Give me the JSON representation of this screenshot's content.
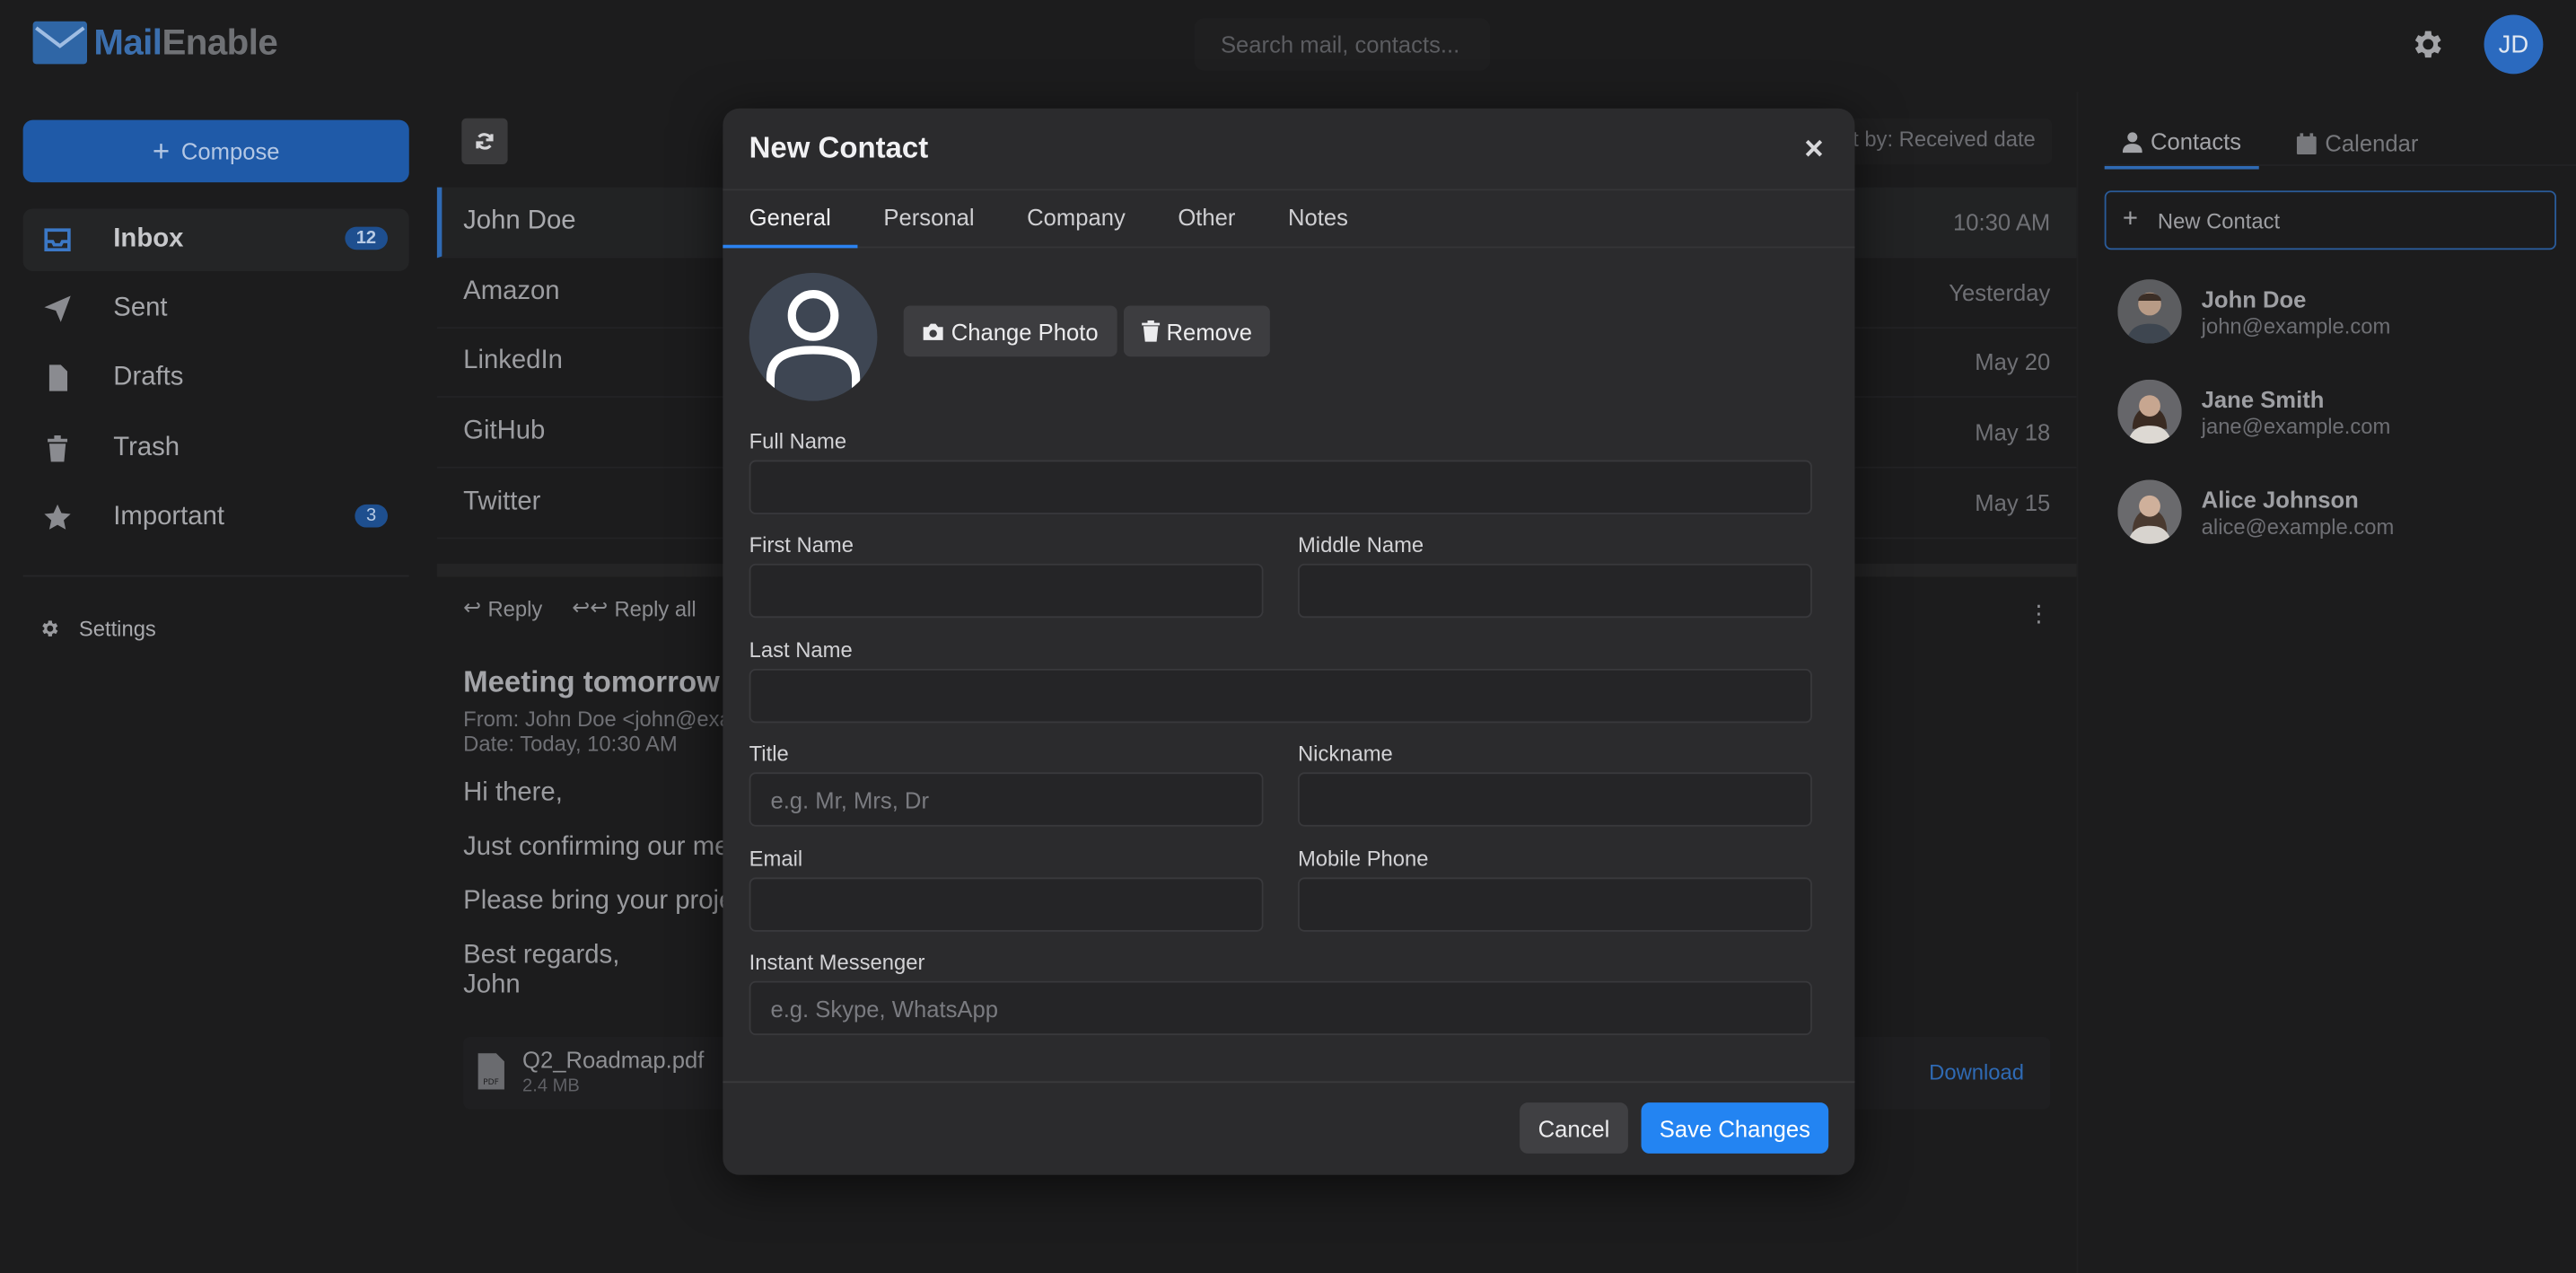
{
  "header": {
    "logo_part1": "Mail",
    "logo_part2": "Enable",
    "search_placeholder": "Search mail, contacts...",
    "avatar_initials": "JD"
  },
  "sidebar": {
    "compose_label": "Compose",
    "items": [
      {
        "label": "Inbox",
        "icon": "inbox-icon",
        "badge": "12",
        "active": true
      },
      {
        "label": "Sent",
        "icon": "paper-plane-icon",
        "badge": ""
      },
      {
        "label": "Drafts",
        "icon": "file-icon",
        "badge": ""
      },
      {
        "label": "Trash",
        "icon": "trash-icon",
        "badge": ""
      },
      {
        "label": "Important",
        "icon": "star-icon",
        "badge": "3"
      }
    ],
    "settings_label": "Settings"
  },
  "mail_list": {
    "sort_label": "Sort by: Received date",
    "rows": [
      {
        "sender": "John Doe",
        "time": "10:30 AM"
      },
      {
        "sender": "Amazon",
        "time": "Yesterday"
      },
      {
        "sender": "LinkedIn",
        "time": "May 20"
      },
      {
        "sender": "GitHub",
        "time": "May 18"
      },
      {
        "sender": "Twitter",
        "time": "May 15"
      }
    ]
  },
  "reading": {
    "actions": [
      "Reply",
      "Reply all"
    ],
    "subject": "Meeting tomorrow",
    "from": "From: John Doe <john@exa",
    "date": "Date: Today, 10:30 AM",
    "lines": [
      "Hi there,",
      "Just confirming our me",
      "Please bring your proje"
    ],
    "signoff1": "Best regards,",
    "signoff2": "John",
    "attachment_name": "Q2_Roadmap.pdf",
    "attachment_size": "2.4 MB",
    "download_label": "Download"
  },
  "right_panel": {
    "tabs": [
      "Contacts",
      "Calendar"
    ],
    "new_contact_label": "New Contact",
    "contacts": [
      {
        "name": "John Doe",
        "email": "john@example.com"
      },
      {
        "name": "Jane Smith",
        "email": "jane@example.com"
      },
      {
        "name": "Alice Johnson",
        "email": "alice@example.com"
      }
    ]
  },
  "modal": {
    "title": "New Contact",
    "close": "×",
    "tabs": [
      "General",
      "Personal",
      "Company",
      "Other",
      "Notes"
    ],
    "change_photo": "Change Photo",
    "remove": "Remove",
    "fields": {
      "full_name": {
        "label": "Full Name",
        "value": "",
        "placeholder": ""
      },
      "first_name": {
        "label": "First Name",
        "value": "",
        "placeholder": ""
      },
      "middle_name": {
        "label": "Middle Name",
        "value": "",
        "placeholder": ""
      },
      "last_name": {
        "label": "Last Name",
        "value": "",
        "placeholder": ""
      },
      "title": {
        "label": "Title",
        "value": "",
        "placeholder": "e.g. Mr, Mrs, Dr"
      },
      "nickname": {
        "label": "Nickname",
        "value": "",
        "placeholder": ""
      },
      "email": {
        "label": "Email",
        "value": "",
        "placeholder": ""
      },
      "mobile_phone": {
        "label": "Mobile Phone",
        "value": "",
        "placeholder": ""
      },
      "instant_messenger": {
        "label": "Instant Messenger",
        "value": "",
        "placeholder": "e.g. Skype, WhatsApp"
      }
    },
    "cancel_label": "Cancel",
    "save_label": "Save Changes"
  },
  "colors": {
    "accent": "#2384f2",
    "brand": "#2f66a6",
    "background": "#1c1c1d",
    "modal_bg": "#2b2b2d"
  }
}
